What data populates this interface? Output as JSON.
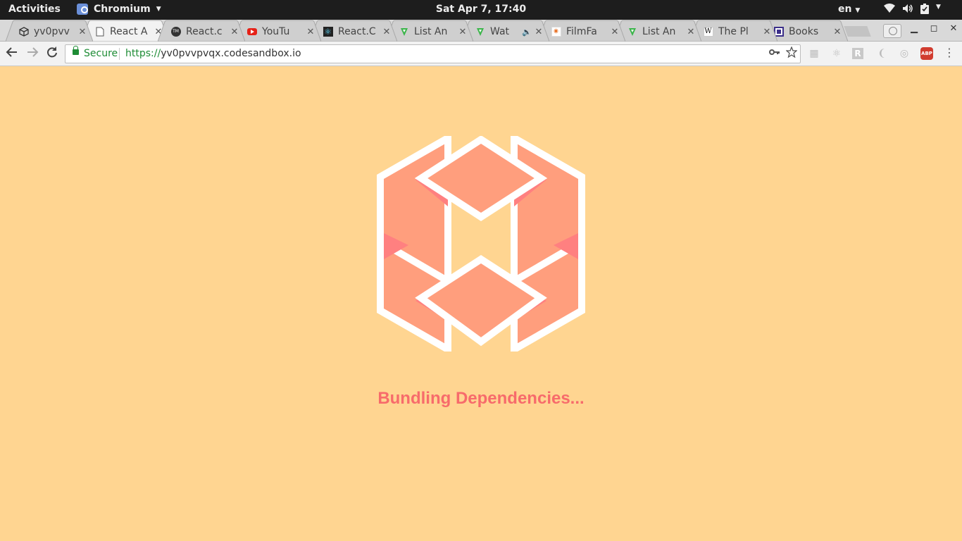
{
  "system_bar": {
    "activities": "Activities",
    "app_name": "Chromium",
    "clock": "Sat Apr  7, 17:40",
    "language": "en"
  },
  "tabs": [
    {
      "title": "yv0pvv",
      "icon": "codesandbox-icon",
      "active": false
    },
    {
      "title": "React A",
      "icon": "page-icon",
      "active": true
    },
    {
      "title": "React.c",
      "icon": "tm-icon",
      "active": false
    },
    {
      "title": "YouTu",
      "icon": "youtube-icon",
      "active": false
    },
    {
      "title": "React.C",
      "icon": "react-icon",
      "active": false
    },
    {
      "title": "List An",
      "icon": "tv-icon",
      "active": false
    },
    {
      "title": "Wat",
      "icon": "tv-icon",
      "active": false
    },
    {
      "title": "FilmFa",
      "icon": "filmfare-icon",
      "active": false
    },
    {
      "title": "List An",
      "icon": "tv-icon",
      "active": false
    },
    {
      "title": "The Pl",
      "icon": "wikipedia-icon",
      "active": false
    },
    {
      "title": "Books",
      "icon": "books-icon",
      "active": false
    }
  ],
  "address_bar": {
    "secure_label": "Secure",
    "url_scheme": "https://",
    "url_host": "yv0pvvpvqx.codesandbox.io"
  },
  "page": {
    "status_text": "Bundling Dependencies...",
    "colors": {
      "background": "#ffd591",
      "status_text": "#f76b6b",
      "logo_fill": "#ff9e7d",
      "logo_accent": "#ff8080",
      "logo_stroke": "#ffffff"
    }
  }
}
